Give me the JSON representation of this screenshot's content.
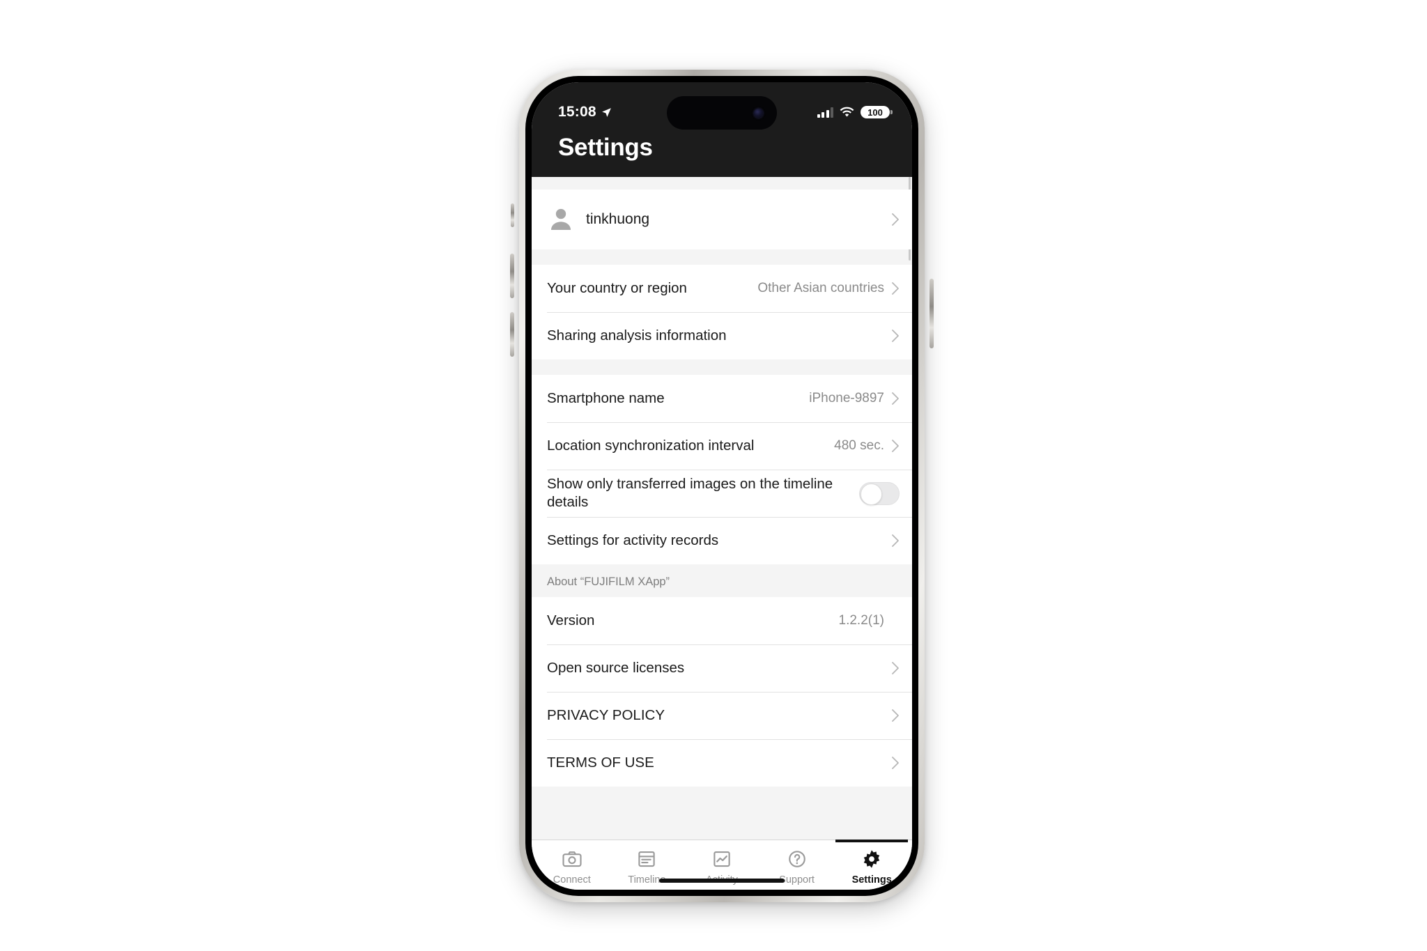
{
  "status_bar": {
    "time": "15:08",
    "location_icon": "location-arrow-icon",
    "signal_icon": "cellular-bars-icon",
    "wifi_icon": "wifi-icon",
    "battery_level": "100"
  },
  "header": {
    "title": "Settings"
  },
  "groups": [
    {
      "rows": [
        {
          "type": "account",
          "label": "tinkhuong",
          "icon": "person-avatar-icon",
          "chevron": true
        }
      ]
    },
    {
      "rows": [
        {
          "type": "nav",
          "label": "Your country or region",
          "value": "Other Asian countries",
          "chevron": true
        },
        {
          "type": "nav",
          "label": "Sharing analysis information",
          "value": "",
          "chevron": true
        }
      ]
    },
    {
      "rows": [
        {
          "type": "nav",
          "label": "Smartphone name",
          "value": "iPhone-9897",
          "chevron": true
        },
        {
          "type": "nav",
          "label": "Location synchronization interval",
          "value": "480 sec.",
          "chevron": true
        },
        {
          "type": "toggle",
          "label": "Show only transferred images on the timeline details",
          "toggle_on": false
        },
        {
          "type": "nav",
          "label": "Settings for activity records",
          "value": "",
          "chevron": true
        }
      ]
    },
    {
      "section_header": "About “FUJIFILM XApp”",
      "rows": [
        {
          "type": "value",
          "label": "Version",
          "value": "1.2.2(1)",
          "chevron": false
        },
        {
          "type": "nav",
          "label": "Open source licenses",
          "value": "",
          "chevron": true
        },
        {
          "type": "nav",
          "label": "PRIVACY POLICY",
          "value": "",
          "chevron": true
        },
        {
          "type": "nav",
          "label": "TERMS OF USE",
          "value": "",
          "chevron": true
        }
      ]
    }
  ],
  "tabs": [
    {
      "label": "Connect",
      "icon": "camera-icon",
      "active": false
    },
    {
      "label": "Timeline",
      "icon": "list-document-icon",
      "active": false
    },
    {
      "label": "Activity",
      "icon": "chart-line-icon",
      "active": false
    },
    {
      "label": "Support",
      "icon": "question-circle-icon",
      "active": false
    },
    {
      "label": "Settings",
      "icon": "gear-icon",
      "active": true
    }
  ],
  "colors": {
    "header_bg": "#1c1c1c",
    "list_bg": "#f4f4f4",
    "row_bg": "#ffffff",
    "label": "#1a1a1a",
    "value": "#8a8a8a",
    "active_tab": "#111111",
    "inactive_tab": "#8e8e8e"
  }
}
